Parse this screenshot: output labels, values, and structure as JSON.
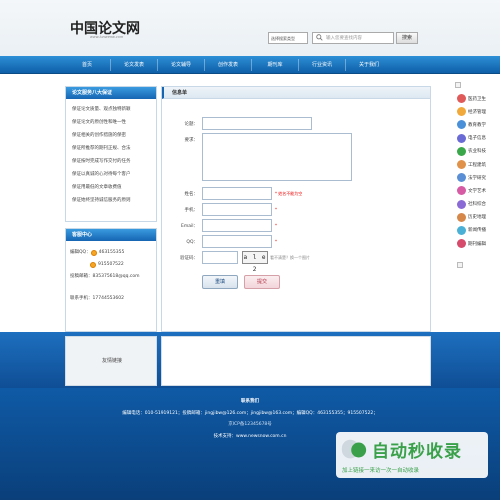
{
  "header": {
    "logo": "中国论文网",
    "logo_sub": "www.lunwenw.com",
    "search_select": "选择搜索类型",
    "search_placeholder": "输入您要查找内容",
    "search_button": "搜索"
  },
  "nav": {
    "items": [
      {
        "label": "首页"
      },
      {
        "label": "论文发表"
      },
      {
        "label": "论文辅导"
      },
      {
        "label": "创作发表"
      },
      {
        "label": "期刊库"
      },
      {
        "label": "行业资讯"
      },
      {
        "label": "关于我们"
      }
    ]
  },
  "guarantee": {
    "title": "论文服务八大保证",
    "items": [
      "保证论文质量、观点独特新颖",
      "保证论文的原创性和唯一性",
      "保证相关的创作措施的保密",
      "保证所推荐的期刊正规、合法",
      "保证按时完成写作交付的任务",
      "保证以真诚的心对待每个客户",
      "保证用最低的文章收费值",
      "保证始终坚持诚信服务的原则"
    ]
  },
  "service": {
    "title": "客服中心",
    "qq_label": "编辑QQ：",
    "qq1": "463155355",
    "qq2": "915507522",
    "email_label": "投稿邮箱：",
    "email": "835375618@qq.com",
    "phone_label": "联系手机：",
    "phone": "17744553602"
  },
  "form": {
    "title": "信息单",
    "subject_label": "论题：",
    "requirement_label": "要求：",
    "name_label": "姓名：",
    "name_note": "* 姓名不能为空",
    "phone_label": "手机：",
    "email_label": "Email：",
    "qq_label": "QQ：",
    "req_mark": "*",
    "captcha_label": "验证码：",
    "captcha_text": "a l e 2",
    "captcha_note": "看不清楚？换一个图片",
    "submit_label": "重填",
    "reset_label": "提交"
  },
  "sidebar": {
    "items": [
      {
        "label": "医药卫生",
        "color": "#e05a5a"
      },
      {
        "label": "经济管理",
        "color": "#f2a93b"
      },
      {
        "label": "教育教学",
        "color": "#4a90d9"
      },
      {
        "label": "电子信息",
        "color": "#6b6bd6"
      },
      {
        "label": "农业科技",
        "color": "#3aa84a"
      },
      {
        "label": "工程建筑",
        "color": "#e0924a"
      },
      {
        "label": "法学研究",
        "color": "#5a8fd6"
      },
      {
        "label": "文学艺术",
        "color": "#d65aa4"
      },
      {
        "label": "社科综合",
        "color": "#8a6bd6"
      },
      {
        "label": "历史地理",
        "color": "#d6884a"
      },
      {
        "label": "新闻传播",
        "color": "#4ab0d6"
      },
      {
        "label": "期刊编辑",
        "color": "#d64a6b"
      }
    ]
  },
  "links": {
    "title": "友情链接"
  },
  "footer": {
    "contact_title": "联系我们",
    "contact_line": "编辑电话：010-51919121；投稿邮箱：jingjibw@126.com；jingjibw@163.com；编辑QQ：463155355；915507522；",
    "icp": "京ICP备12345678号",
    "support": "技术支持：www.newsnow.com.cn"
  },
  "watermark": {
    "title": "自动秒收录",
    "subtitle": "加上链接一来访一次一自动收录"
  }
}
